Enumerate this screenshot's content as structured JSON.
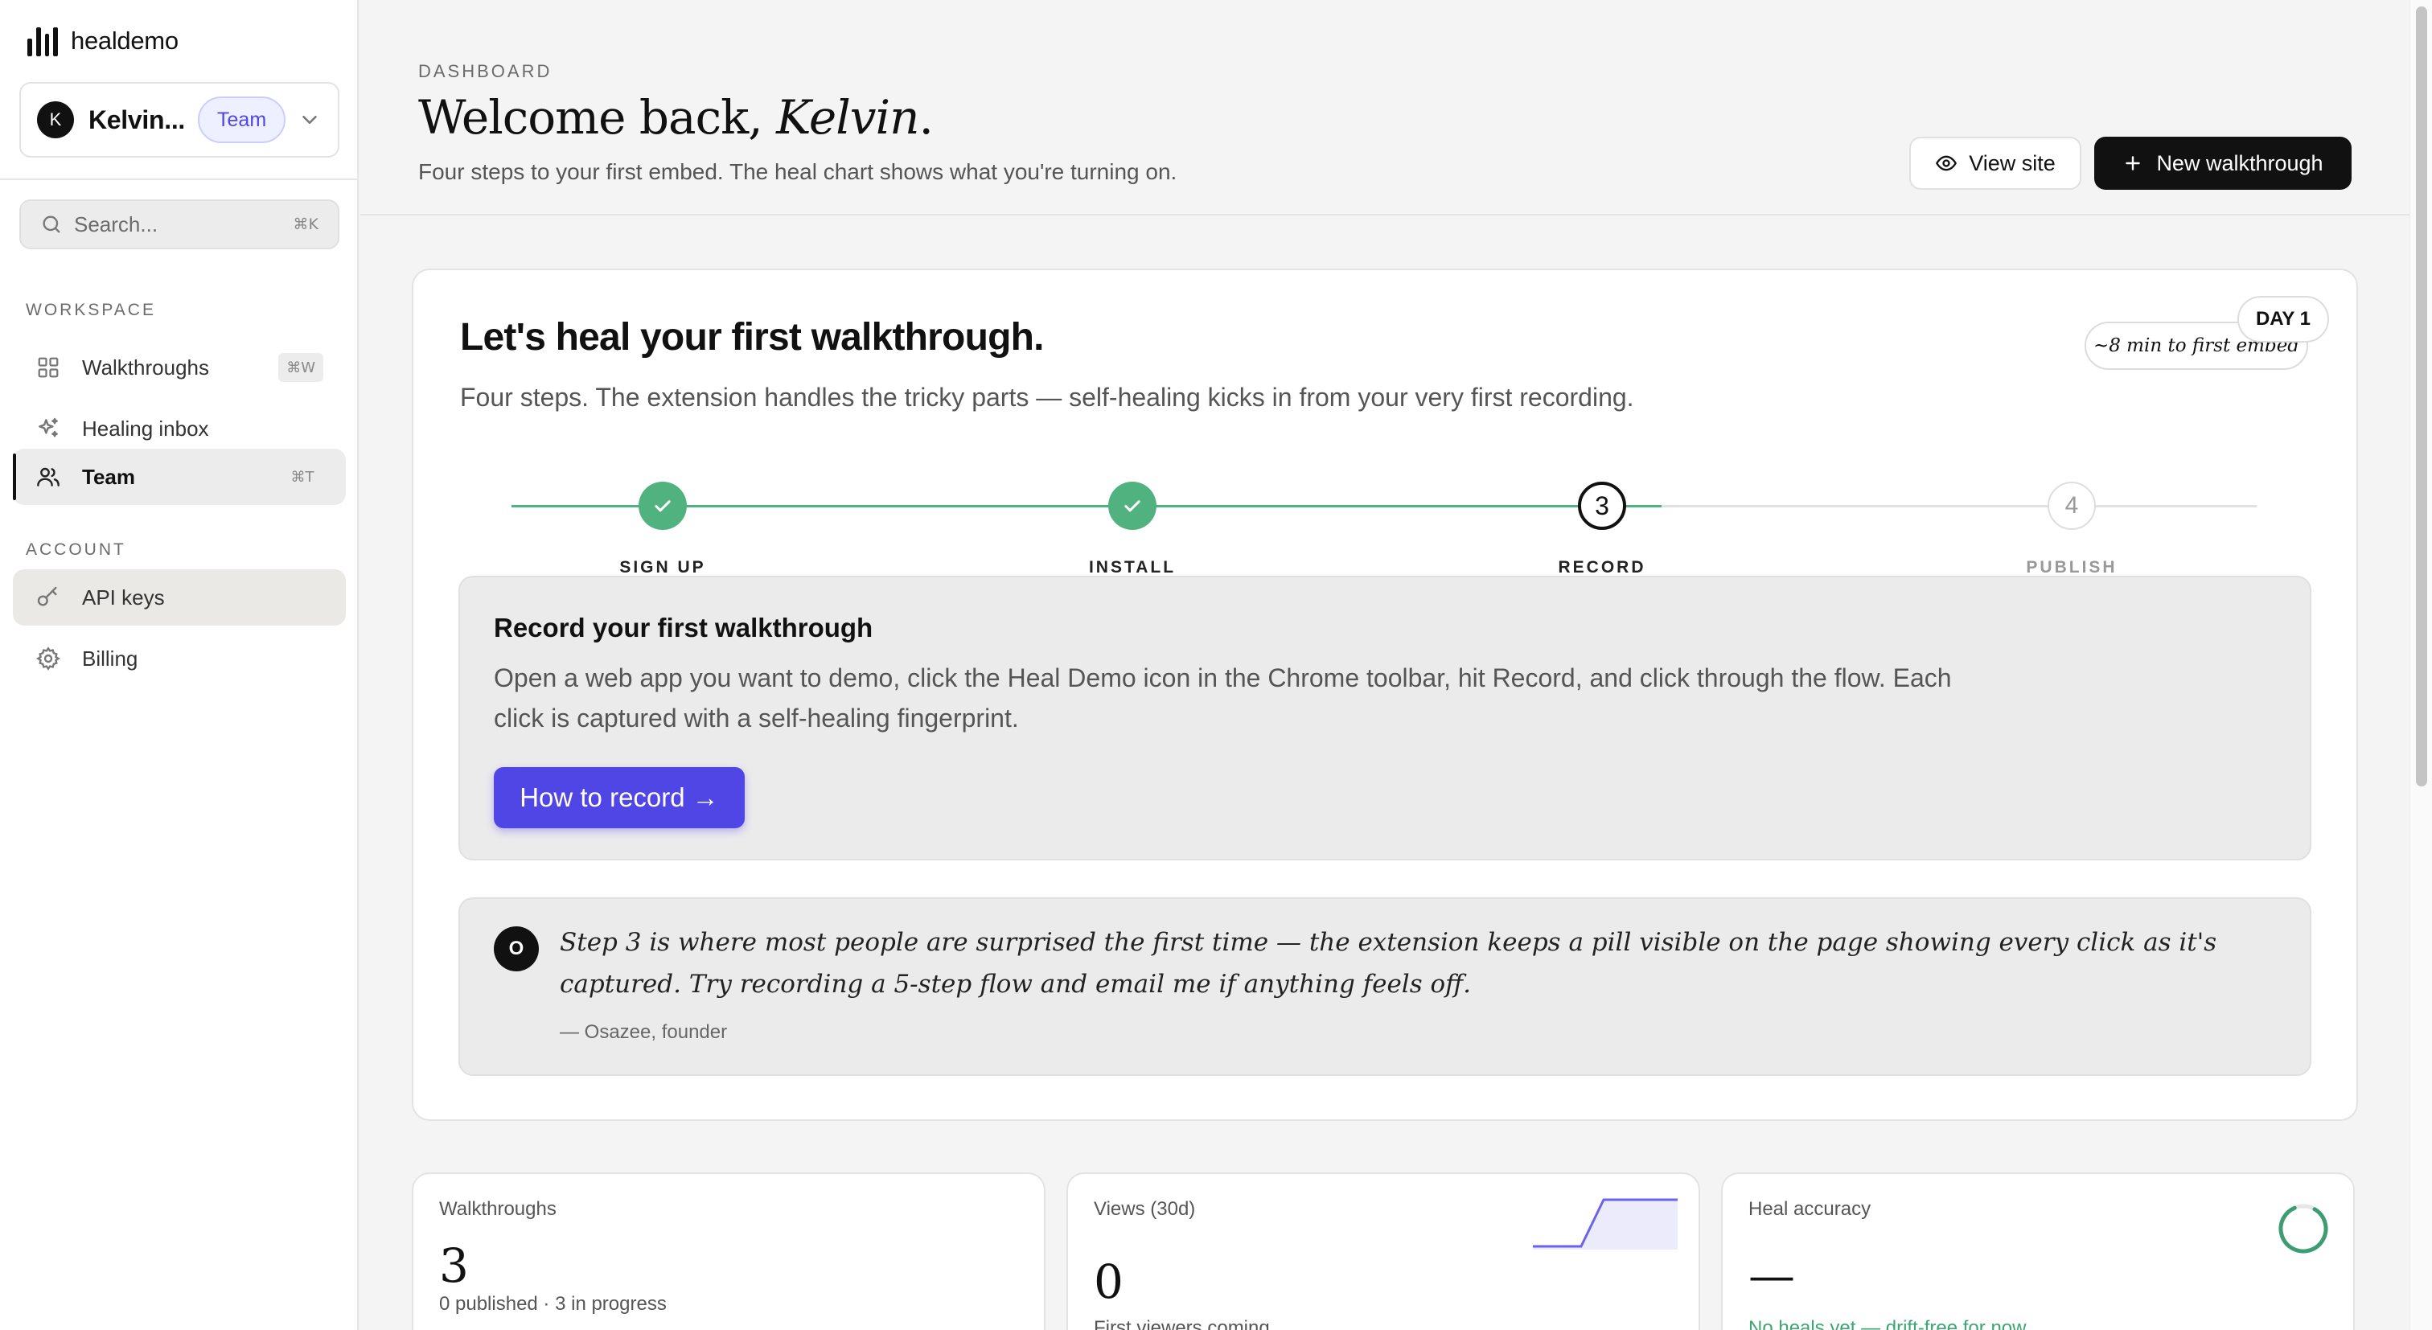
{
  "brand": {
    "name": "healdemo"
  },
  "workspace": {
    "avatar_letter": "K",
    "name": "Kelvin...",
    "badge": "Team"
  },
  "search": {
    "placeholder": "Search...",
    "shortcut": "⌘K"
  },
  "sidebar": {
    "workspace_label": "WORKSPACE",
    "account_label": "ACCOUNT",
    "items": [
      {
        "label": "Walkthroughs",
        "shortcut": "⌘W",
        "icon": "grid-icon"
      },
      {
        "label": "Healing inbox",
        "shortcut": "",
        "icon": "sparkles-icon"
      },
      {
        "label": "Team",
        "shortcut": "⌘T",
        "icon": "users-icon",
        "active": true
      },
      {
        "label": "API keys",
        "shortcut": "",
        "icon": "key-icon"
      },
      {
        "label": "Billing",
        "shortcut": "",
        "icon": "gear-icon"
      }
    ]
  },
  "header": {
    "eyebrow": "DASHBOARD",
    "title_prefix": "Welcome back, ",
    "title_name": "Kelvin",
    "title_suffix": ".",
    "subtitle": "Four steps to your first embed. The heal chart shows what you're turning on.",
    "view_site_label": "View site",
    "new_walkthrough_label": "New walkthrough"
  },
  "onboarding": {
    "title": "Let's heal your first walkthrough.",
    "subtitle": "Four steps. The extension handles the tricky parts — self-healing kicks in from your very first recording.",
    "day_badge": "DAY 1",
    "time_estimate": "~8 min to first embed",
    "steps": [
      {
        "label": "SIGN UP",
        "status": "done",
        "number": "1"
      },
      {
        "label": "INSTALL",
        "status": "done",
        "number": "2"
      },
      {
        "label": "RECORD",
        "status": "current",
        "number": "3"
      },
      {
        "label": "PUBLISH",
        "status": "todo",
        "number": "4"
      }
    ],
    "record": {
      "title": "Record your first walkthrough",
      "body": "Open a web app you want to demo, click the Heal Demo icon in the Chrome toolbar, hit Record, and click through the flow. Each click is captured with a self-healing fingerprint.",
      "button_label": "How to record →"
    },
    "note": {
      "avatar_letter": "O",
      "quote": "Step 3 is where most people are surprised the first time — the extension keeps a pill visible on the page showing every click as it's captured. Try recording a 5-step flow and email me if anything feels off.",
      "author": "— Osazee, founder"
    }
  },
  "stats": [
    {
      "label": "Walkthroughs",
      "value": "3",
      "sub": "0 published · 3 in progress"
    },
    {
      "label": "Views (30d)",
      "value": "0",
      "sub": "First viewers coming"
    },
    {
      "label": "Heal accuracy",
      "value": "—",
      "sub": "No heals yet — drift-free for now"
    }
  ],
  "colors": {
    "accent": "#4f46e5",
    "success": "#4fb27f",
    "dark": "#111111"
  }
}
